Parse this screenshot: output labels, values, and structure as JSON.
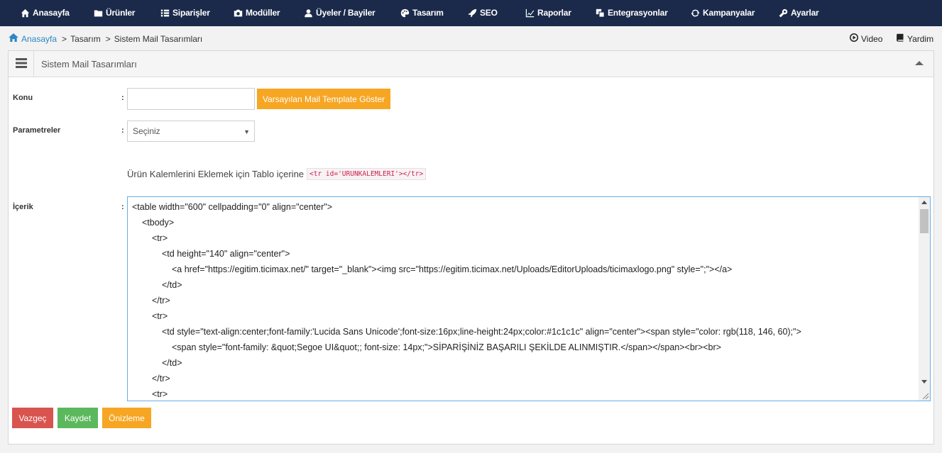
{
  "nav": [
    {
      "label": "Anasayfa",
      "icon": "home-icon"
    },
    {
      "label": "Ürünler",
      "icon": "folder-icon"
    },
    {
      "label": "Siparişler",
      "icon": "list-icon"
    },
    {
      "label": "Modüller",
      "icon": "camera-icon"
    },
    {
      "label": "Üyeler / Bayiler",
      "icon": "users-icon"
    },
    {
      "label": "Tasarım",
      "icon": "palette-icon"
    },
    {
      "label": "SEO",
      "icon": "rocket-icon"
    },
    {
      "label": "Raporlar",
      "icon": "chart-icon"
    },
    {
      "label": "Entegrasyonlar",
      "icon": "integration-icon"
    },
    {
      "label": "Kampanyalar",
      "icon": "refresh-icon"
    },
    {
      "label": "Ayarlar",
      "icon": "wrench-icon"
    }
  ],
  "breadcrumb": {
    "home": "Anasayfa",
    "sep": ">",
    "items": [
      "Tasarım",
      "Sistem Mail Tasarımları"
    ]
  },
  "top_links": {
    "video": "Video",
    "help": "Yardim"
  },
  "panel": {
    "title": "Sistem Mail Tasarımları"
  },
  "form": {
    "konu_label": "Konu",
    "colon": ":",
    "konu_value": "",
    "default_template_button": "Varsayılan Mail Template Göster",
    "parametreler_label": "Parametreler",
    "parametreler_selected": "Seçiniz",
    "hint_text": "Ürün Kalemlerini Eklemek için Tablo içerine",
    "hint_code": "<tr id='URUNKALEMLERI'></tr>",
    "icerik_label": "İçerik"
  },
  "editor_lines": [
    "<table width=\"600\" cellpadding=\"0\" align=\"center\">",
    "<tbody>",
    "<tr>",
    "<td height=\"140\" align=\"center\">",
    "<a href=\"https://egitim.ticimax.net/\" target=\"_blank\"><img src=\"https://egitim.ticimax.net/Uploads/EditorUploads/ticimaxlogo.png\" style=\";\"></a>",
    "</td>",
    "</tr>",
    "<tr>",
    "<td style=\"text-align:center;font-family:'Lucida Sans Unicode';font-size:16px;line-height:24px;color:#1c1c1c\" align=\"center\"><span style=\"color: rgb(118, 146, 60);\">",
    "<span style=\"font-family: &quot;Segoe UI&quot;; font-size: 14px;\">SİPARİŞİNİZ BAŞARILI ŞEKİLDE ALINMIŞTIR.</span></span><br><br>",
    "</td>",
    "</tr>",
    "<tr>"
  ],
  "actions": {
    "cancel": "Vazgeç",
    "save": "Kaydet",
    "preview": "Önizleme"
  }
}
